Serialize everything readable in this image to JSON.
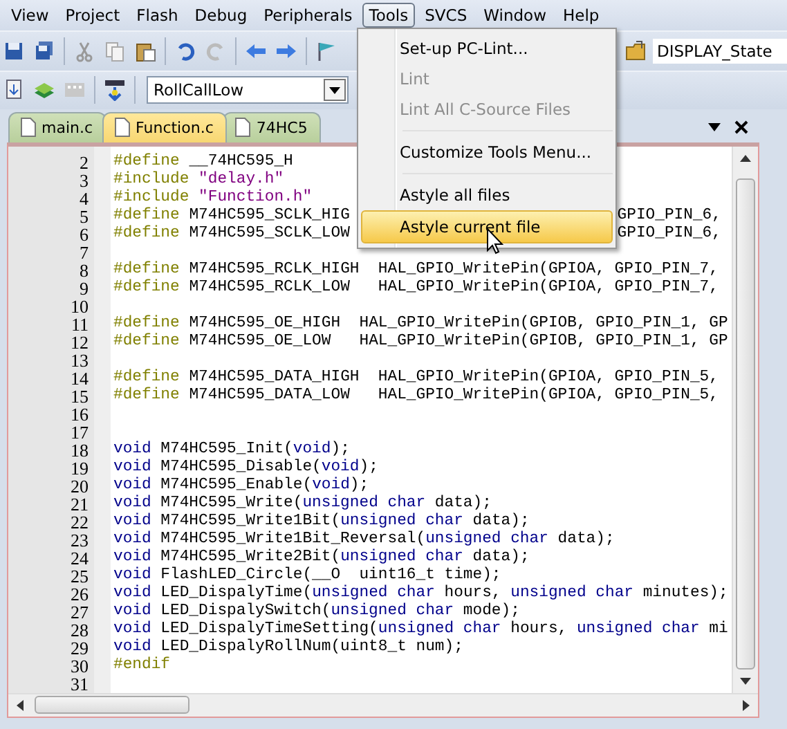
{
  "menu_bar": [
    {
      "label": "View",
      "selected": false
    },
    {
      "label": "Project",
      "selected": false
    },
    {
      "label": "Flash",
      "selected": false
    },
    {
      "label": "Debug",
      "selected": false
    },
    {
      "label": "Peripherals",
      "selected": false
    },
    {
      "label": "Tools",
      "selected": true
    },
    {
      "label": "SVCS",
      "selected": false
    },
    {
      "label": "Window",
      "selected": false
    },
    {
      "label": "Help",
      "selected": false
    }
  ],
  "toolbar": {
    "find_field": {
      "value": "DISPLAY_State"
    }
  },
  "build_toolbar": {
    "target_select": {
      "value": "RollCallLow"
    }
  },
  "tabs": [
    {
      "label": "main.c",
      "selected": false
    },
    {
      "label": "Function.c",
      "selected": true
    },
    {
      "label": "74HC5",
      "selected": false
    }
  ],
  "editor": {
    "lines": [
      {
        "number": "2",
        "tokens": [
          {
            "kind": "directive",
            "text": "#define"
          },
          {
            "kind": "plain",
            "text": " __74HC595_H"
          }
        ]
      },
      {
        "number": "3",
        "tokens": [
          {
            "kind": "directive",
            "text": "#include"
          },
          {
            "kind": "string",
            "text": " \"delay.h\""
          }
        ]
      },
      {
        "number": "4",
        "tokens": [
          {
            "kind": "directive",
            "text": "#include"
          },
          {
            "kind": "string",
            "text": " \"Function.h\""
          }
        ]
      },
      {
        "number": "5",
        "tokens": [
          {
            "kind": "directive",
            "text": "#define"
          },
          {
            "kind": "plain",
            "text": " M74HC595_SCLK_HIG"
          }
        ],
        "after_menu": "GPIO_PIN_6,"
      },
      {
        "number": "6",
        "tokens": [
          {
            "kind": "directive",
            "text": "#define"
          },
          {
            "kind": "plain",
            "text": " M74HC595_SCLK_LOW"
          }
        ],
        "after_menu": "GPIO_PIN_6,"
      },
      {
        "number": "7"
      },
      {
        "number": "8",
        "tokens": [
          {
            "kind": "directive",
            "text": "#define"
          },
          {
            "kind": "plain",
            "text": " M74HC595_RCLK_HIGH  HAL_GPIO_WritePin(GPIOA, GPIO_PIN_7,"
          }
        ]
      },
      {
        "number": "9",
        "tokens": [
          {
            "kind": "directive",
            "text": "#define"
          },
          {
            "kind": "plain",
            "text": " M74HC595_RCLK_LOW   HAL_GPIO_WritePin(GPIOA, GPIO_PIN_7,"
          }
        ]
      },
      {
        "number": "10"
      },
      {
        "number": "11",
        "tokens": [
          {
            "kind": "directive",
            "text": "#define"
          },
          {
            "kind": "plain",
            "text": " M74HC595_OE_HIGH  HAL_GPIO_WritePin(GPIOB, GPIO_PIN_1, GP"
          }
        ]
      },
      {
        "number": "12",
        "tokens": [
          {
            "kind": "directive",
            "text": "#define"
          },
          {
            "kind": "plain",
            "text": " M74HC595_OE_LOW   HAL_GPIO_WritePin(GPIOB, GPIO_PIN_1, GP"
          }
        ]
      },
      {
        "number": "13"
      },
      {
        "number": "14",
        "tokens": [
          {
            "kind": "directive",
            "text": "#define"
          },
          {
            "kind": "plain",
            "text": " M74HC595_DATA_HIGH  HAL_GPIO_WritePin(GPIOA, GPIO_PIN_5,"
          }
        ]
      },
      {
        "number": "15",
        "tokens": [
          {
            "kind": "directive",
            "text": "#define"
          },
          {
            "kind": "plain",
            "text": " M74HC595_DATA_LOW   HAL_GPIO_WritePin(GPIOA, GPIO_PIN_5,"
          }
        ]
      },
      {
        "number": "16"
      },
      {
        "number": "17"
      },
      {
        "number": "18",
        "tokens": [
          {
            "kind": "keyword",
            "text": "void"
          },
          {
            "kind": "plain",
            "text": " M74HC595_Init("
          },
          {
            "kind": "keyword",
            "text": "void"
          },
          {
            "kind": "plain",
            "text": ");"
          }
        ]
      },
      {
        "number": "19",
        "tokens": [
          {
            "kind": "keyword",
            "text": "void"
          },
          {
            "kind": "plain",
            "text": " M74HC595_Disable("
          },
          {
            "kind": "keyword",
            "text": "void"
          },
          {
            "kind": "plain",
            "text": ");"
          }
        ]
      },
      {
        "number": "20",
        "tokens": [
          {
            "kind": "keyword",
            "text": "void"
          },
          {
            "kind": "plain",
            "text": " M74HC595_Enable("
          },
          {
            "kind": "keyword",
            "text": "void"
          },
          {
            "kind": "plain",
            "text": ");"
          }
        ]
      },
      {
        "number": "21",
        "tokens": [
          {
            "kind": "keyword",
            "text": "void"
          },
          {
            "kind": "plain",
            "text": " M74HC595_Write("
          },
          {
            "kind": "keyword",
            "text": "unsigned char"
          },
          {
            "kind": "plain",
            "text": " data);"
          }
        ]
      },
      {
        "number": "22",
        "tokens": [
          {
            "kind": "keyword",
            "text": "void"
          },
          {
            "kind": "plain",
            "text": " M74HC595_Write1Bit("
          },
          {
            "kind": "keyword",
            "text": "unsigned char"
          },
          {
            "kind": "plain",
            "text": " data);"
          }
        ]
      },
      {
        "number": "23",
        "tokens": [
          {
            "kind": "keyword",
            "text": "void"
          },
          {
            "kind": "plain",
            "text": " M74HC595_Write1Bit_Reversal("
          },
          {
            "kind": "keyword",
            "text": "unsigned char"
          },
          {
            "kind": "plain",
            "text": " data);"
          }
        ]
      },
      {
        "number": "24",
        "tokens": [
          {
            "kind": "keyword",
            "text": "void"
          },
          {
            "kind": "plain",
            "text": " M74HC595_Write2Bit("
          },
          {
            "kind": "keyword",
            "text": "unsigned char"
          },
          {
            "kind": "plain",
            "text": " data);"
          }
        ]
      },
      {
        "number": "25",
        "tokens": [
          {
            "kind": "keyword",
            "text": "void"
          },
          {
            "kind": "plain",
            "text": " FlashLED_Circle(__O  uint16_t time);"
          }
        ]
      },
      {
        "number": "26",
        "tokens": [
          {
            "kind": "keyword",
            "text": "void"
          },
          {
            "kind": "plain",
            "text": " LED_DispalyTime("
          },
          {
            "kind": "keyword",
            "text": "unsigned char"
          },
          {
            "kind": "plain",
            "text": " hours, "
          },
          {
            "kind": "keyword",
            "text": "unsigned char"
          },
          {
            "kind": "plain",
            "text": " minutes);"
          }
        ]
      },
      {
        "number": "27",
        "tokens": [
          {
            "kind": "keyword",
            "text": "void"
          },
          {
            "kind": "plain",
            "text": " LED_DispalySwitch("
          },
          {
            "kind": "keyword",
            "text": "unsigned char"
          },
          {
            "kind": "plain",
            "text": " mode);"
          }
        ]
      },
      {
        "number": "28",
        "tokens": [
          {
            "kind": "keyword",
            "text": "void"
          },
          {
            "kind": "plain",
            "text": " LED_DispalyTimeSetting("
          },
          {
            "kind": "keyword",
            "text": "unsigned char"
          },
          {
            "kind": "plain",
            "text": " hours, "
          },
          {
            "kind": "keyword",
            "text": "unsigned char"
          },
          {
            "kind": "plain",
            "text": " mi"
          }
        ]
      },
      {
        "number": "29",
        "tokens": [
          {
            "kind": "keyword",
            "text": "void"
          },
          {
            "kind": "plain",
            "text": " LED_DispalyRollNum(uint8_t num);"
          }
        ]
      },
      {
        "number": "30",
        "tokens": [
          {
            "kind": "directive",
            "text": "#endif"
          }
        ]
      },
      {
        "number": "31"
      }
    ]
  },
  "tools_menu": {
    "items": [
      {
        "kind": "item",
        "label": "Set-up PC-Lint...",
        "disabled": false,
        "selected": false
      },
      {
        "kind": "item",
        "label": "Lint",
        "disabled": true,
        "selected": false
      },
      {
        "kind": "item",
        "label": "Lint All C-Source Files",
        "disabled": true,
        "selected": false
      },
      {
        "kind": "separator"
      },
      {
        "kind": "item",
        "label": "Customize Tools Menu...",
        "disabled": false,
        "selected": false
      },
      {
        "kind": "separator"
      },
      {
        "kind": "item",
        "label": "Astyle all files",
        "disabled": false,
        "selected": false
      },
      {
        "kind": "item",
        "label": "Astyle current file",
        "disabled": false,
        "selected": true
      }
    ]
  }
}
